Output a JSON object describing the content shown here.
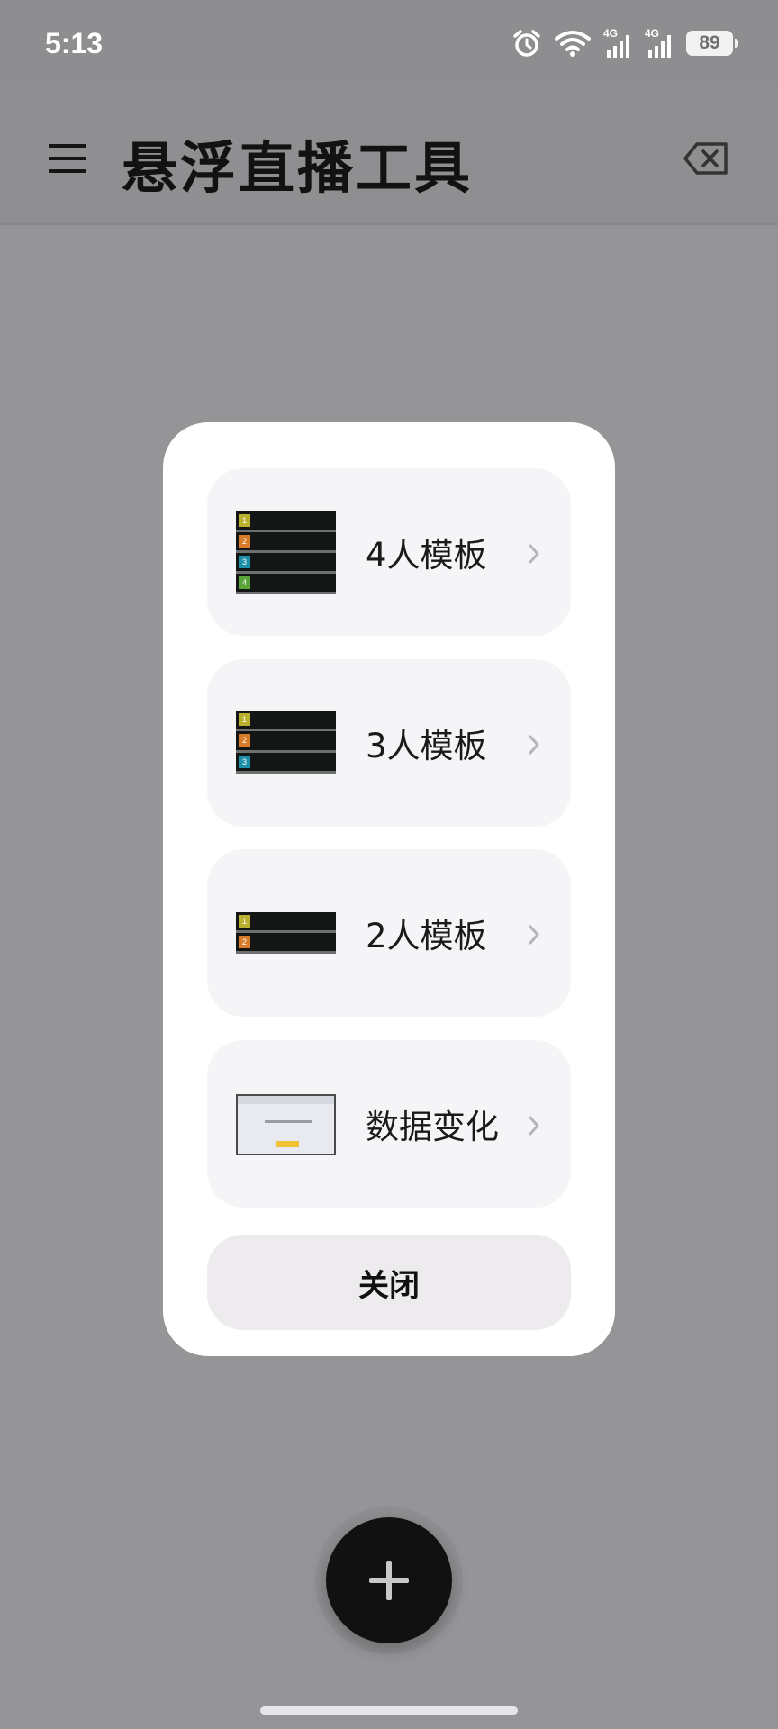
{
  "status_bar": {
    "time": "5:13",
    "battery": "89",
    "icons": [
      "alarm-icon",
      "wifi-icon",
      "signal-4g-icon",
      "signal-4g-icon",
      "battery-icon"
    ],
    "network_labels": [
      "4G",
      "4G"
    ]
  },
  "app_bar": {
    "title": "悬浮直播工具",
    "menu_icon": "menu-icon",
    "action_icon": "backspace-icon"
  },
  "dialog": {
    "options": [
      {
        "label": "4人模板",
        "thumb_numbers": [
          "1",
          "2",
          "3",
          "4"
        ]
      },
      {
        "label": "3人模板",
        "thumb_numbers": [
          "1",
          "2",
          "3"
        ]
      },
      {
        "label": "2人模板",
        "thumb_numbers": [
          "1",
          "2"
        ]
      },
      {
        "label": "数据变化"
      }
    ],
    "close_label": "关闭"
  },
  "fab": {
    "icon": "plus-icon"
  },
  "colors": {
    "scrim": "#959497",
    "dialog_bg": "#ffffff",
    "card_bg": "#f5f5f8",
    "close_bg": "#edebed",
    "fab_bg": "#111111"
  }
}
